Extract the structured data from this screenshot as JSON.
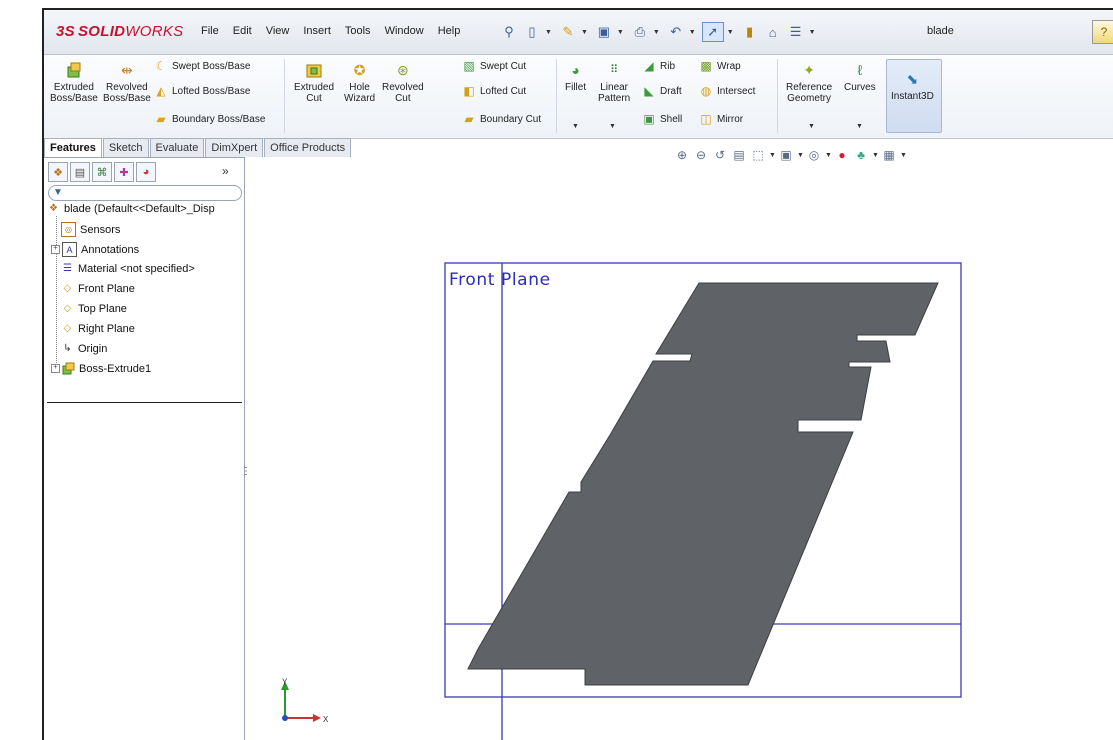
{
  "app": {
    "logo_text_ds": "3S",
    "logo_text_solid": "SOLID",
    "logo_text_works": "WORKS",
    "document_title": "blade"
  },
  "menus": [
    "File",
    "Edit",
    "View",
    "Insert",
    "Tools",
    "Window",
    "Help"
  ],
  "ribbon": {
    "extruded_boss": [
      "Extruded",
      "Boss/Base"
    ],
    "revolved_boss": [
      "Revolved",
      "Boss/Base"
    ],
    "swept_boss": "Swept Boss/Base",
    "lofted_boss": "Lofted Boss/Base",
    "boundary_boss": "Boundary Boss/Base",
    "extruded_cut": [
      "Extruded",
      "Cut"
    ],
    "hole_wizard": [
      "Hole",
      "Wizard"
    ],
    "revolved_cut": [
      "Revolved",
      "Cut"
    ],
    "swept_cut": "Swept Cut",
    "lofted_cut": "Lofted Cut",
    "boundary_cut": "Boundary Cut",
    "fillet": "Fillet",
    "linear_pattern": [
      "Linear",
      "Pattern"
    ],
    "rib": "Rib",
    "draft": "Draft",
    "shell": "Shell",
    "wrap": "Wrap",
    "intersect": "Intersect",
    "mirror": "Mirror",
    "reference_geometry": [
      "Reference",
      "Geometry"
    ],
    "curves": "Curves",
    "instant3d": "Instant3D"
  },
  "tabs": [
    "Features",
    "Sketch",
    "Evaluate",
    "DimXpert",
    "Office Products"
  ],
  "active_tab": "Features",
  "feature_tree": {
    "root": "blade  (Default<<Default>_Disp",
    "items": [
      {
        "label": "Sensors",
        "icon": "sensors-icon"
      },
      {
        "label": "Annotations",
        "icon": "annotations-icon",
        "expandable": true
      },
      {
        "label": "Material <not specified>",
        "icon": "material-icon"
      },
      {
        "label": "Front Plane",
        "icon": "plane-icon"
      },
      {
        "label": "Top Plane",
        "icon": "plane-icon"
      },
      {
        "label": "Right Plane",
        "icon": "plane-icon"
      },
      {
        "label": "Origin",
        "icon": "origin-icon"
      },
      {
        "label": "Boss-Extrude1",
        "icon": "extrude-icon",
        "expandable": true
      }
    ]
  },
  "graphics": {
    "plane_label": "Front Plane",
    "triad_y": "Y",
    "triad_x": "X"
  },
  "colors": {
    "part_fill": "#5f6266",
    "plane_border": "#3a3ab8",
    "plane_text": "#2b2bbf",
    "brand": "#c8102e"
  }
}
